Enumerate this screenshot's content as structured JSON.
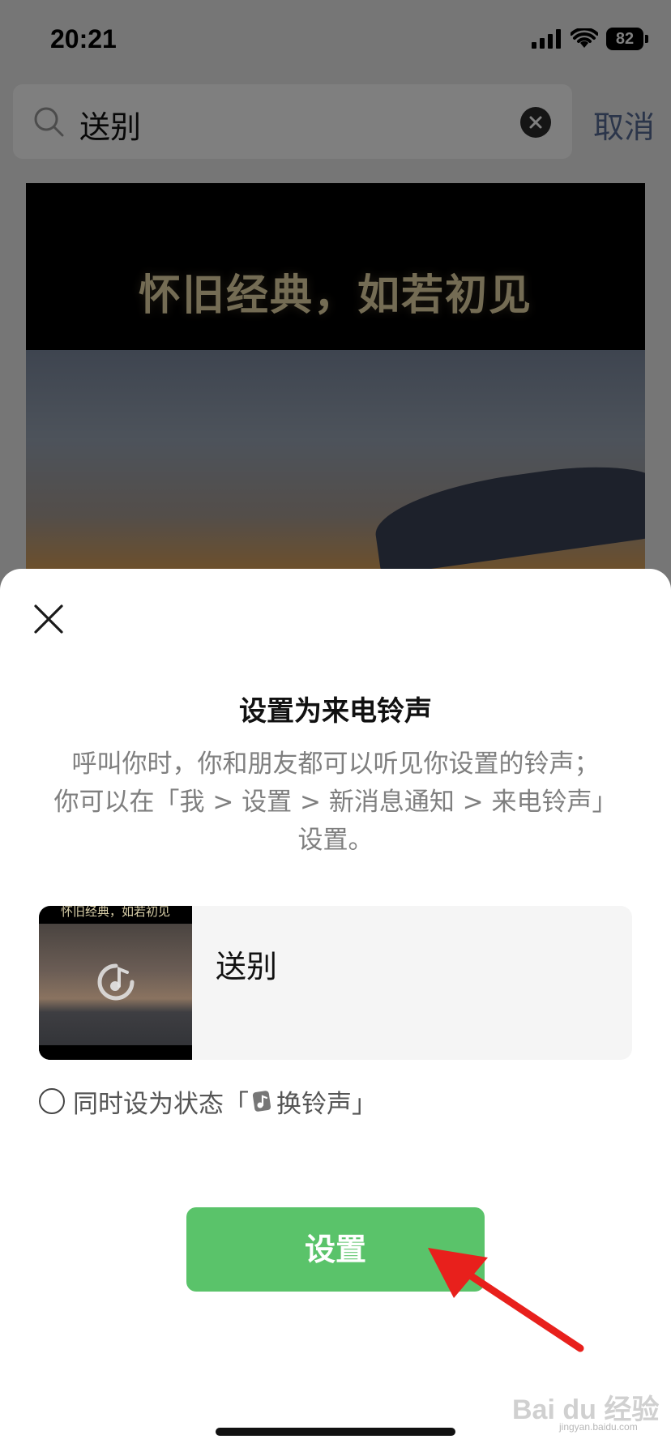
{
  "status_bar": {
    "time": "20:21",
    "battery": "82"
  },
  "search": {
    "query": "送别",
    "cancel_label": "取消"
  },
  "video": {
    "title": "怀旧经典，如若初见"
  },
  "sheet": {
    "title": "设置为来电铃声",
    "desc_lines": [
      "呼叫你时，你和朋友都可以听见你设置的铃声；",
      "你可以在「我 > 设置 > 新消息通知 > 来电铃声」",
      "设置。"
    ],
    "song": {
      "thumb_title": "怀旧经典，如若初见",
      "name": "送别"
    },
    "status_option": {
      "prefix": "同时设为状态「",
      "suffix": "换铃声」"
    },
    "confirm_label": "设置"
  },
  "watermark": {
    "main": "Bai du 经验",
    "sub": "jingyan.baidu.com"
  },
  "colors": {
    "accent_green": "#5ac36a",
    "link_blue": "#576b95",
    "annotation_red": "#e8201c"
  }
}
